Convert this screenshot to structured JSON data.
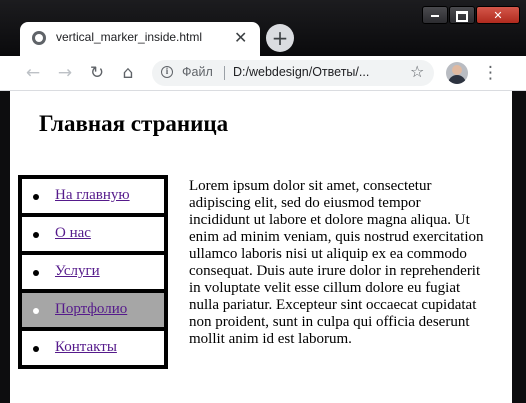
{
  "browser": {
    "tab_title": "vertical_marker_inside.html",
    "tab_close": "✕",
    "new_tab": "+",
    "scheme_label": "Файл",
    "url": "D:/webdesign/Ответы/...",
    "nav": {
      "back": "←",
      "forward": "→",
      "reload": "↻",
      "home": "⌂"
    },
    "star": "☆",
    "menu": "⋮",
    "window_close": "✕"
  },
  "page": {
    "heading": "Главная страница",
    "menu_items": [
      {
        "label": "На главную",
        "active": false
      },
      {
        "label": "О нас",
        "active": false
      },
      {
        "label": "Услуги",
        "active": false
      },
      {
        "label": "Портфолио",
        "active": true
      },
      {
        "label": "Контакты",
        "active": false
      }
    ],
    "body_text": "Lorem ipsum dolor sit amet, consectetur adipiscing elit, sed do eiusmod tempor incididunt ut labore et dolore magna aliqua. Ut enim ad minim veniam, quis nostrud exercitation ullamco laboris nisi ut aliquip ex ea commodo consequat. Duis aute irure dolor in reprehenderit in voluptate velit esse cillum dolore eu fugiat nulla pariatur. Excepteur sint occaecat cupidatat non proident, sunt in culpa qui officia deserunt mollit anim id est laborum."
  },
  "icons": [
    "globe-icon",
    "close-icon",
    "plus-icon",
    "minimize-icon",
    "maximize-icon",
    "back-arrow-icon",
    "forward-arrow-icon",
    "reload-icon",
    "home-icon",
    "info-icon",
    "star-icon",
    "kebab-menu-icon"
  ],
  "colors": {
    "active_item": "#a6a6a6",
    "link": "#551a8b",
    "frame": "#0d0d0f"
  }
}
